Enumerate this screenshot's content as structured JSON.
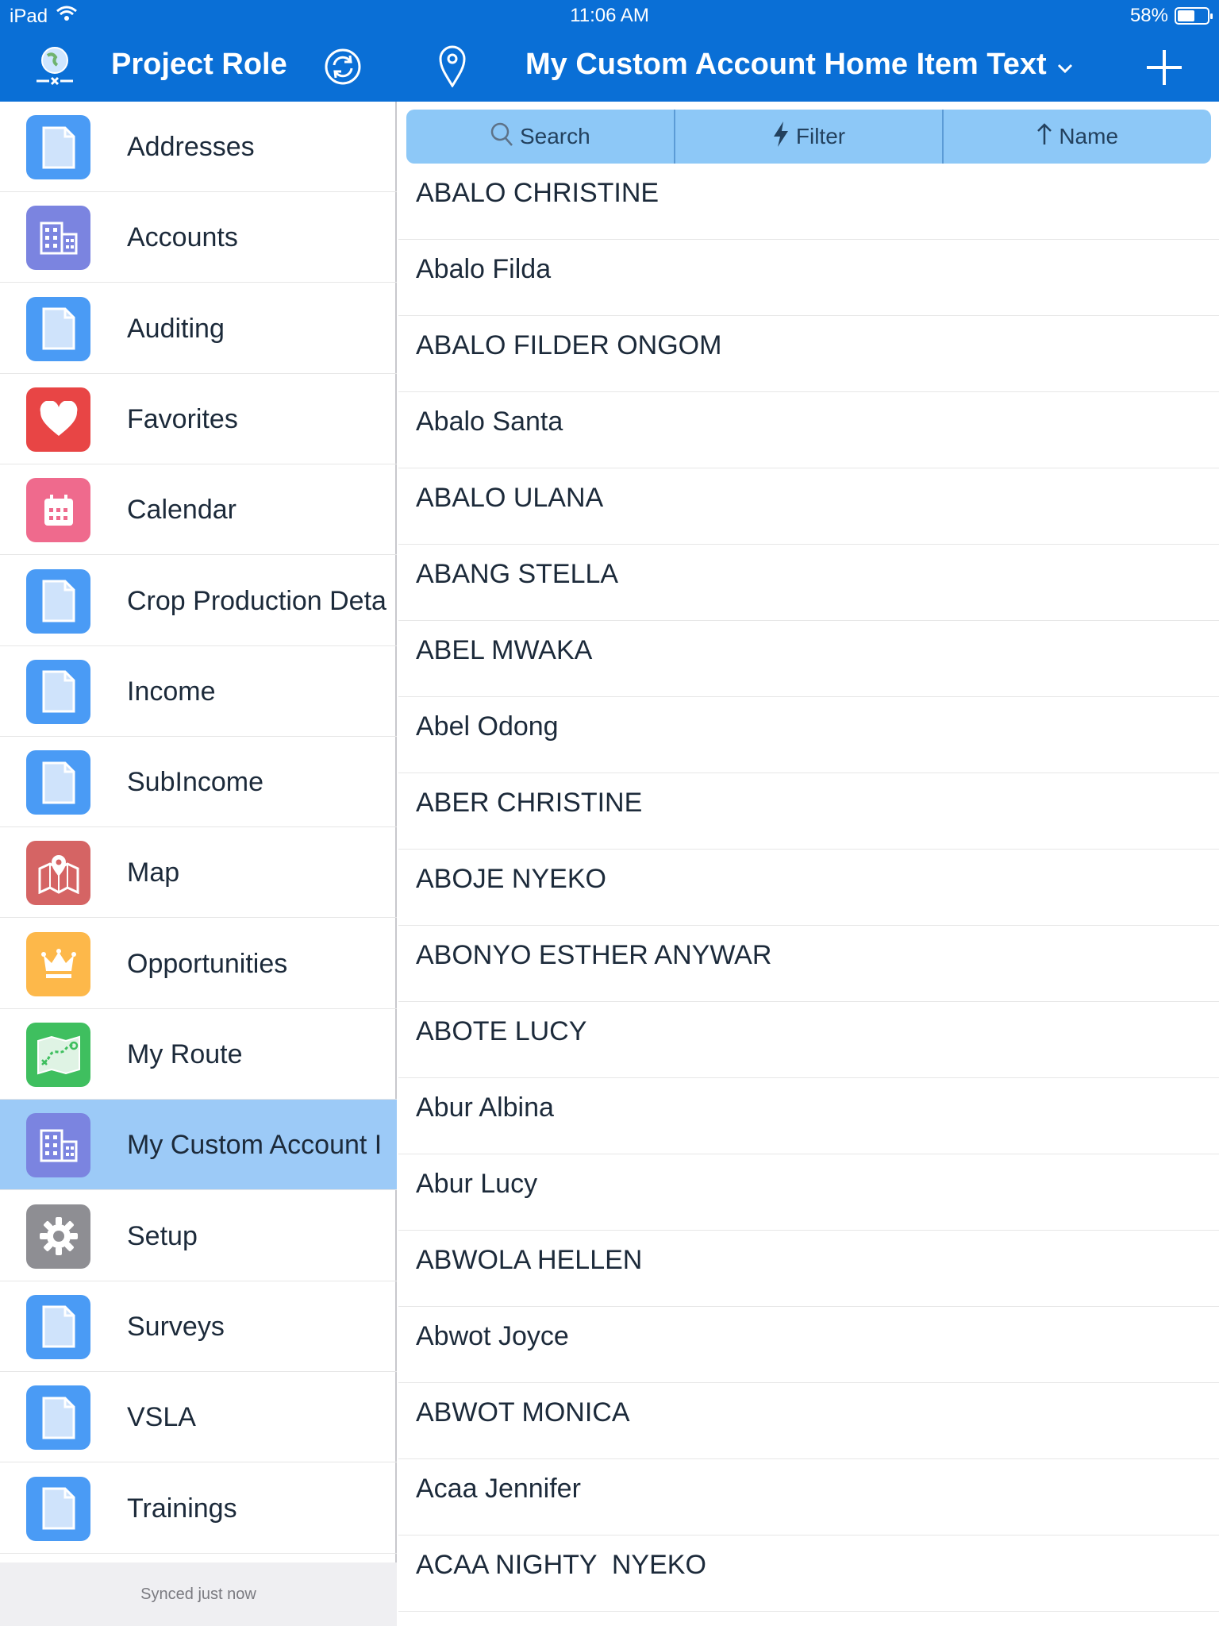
{
  "status_bar": {
    "device": "iPad",
    "time": "11:06 AM",
    "battery": "58%",
    "battery_level": 0.58
  },
  "nav": {
    "left_title": "Project Role",
    "center_title": "My Custom Account Home Item Text",
    "icons": [
      "globe-icon",
      "sync-icon",
      "location-pin-icon",
      "chevron-down-icon",
      "plus-icon"
    ]
  },
  "sidebar": {
    "items": [
      {
        "label": "Addresses",
        "icon": "document-icon",
        "color": "#4a9bf5"
      },
      {
        "label": "Accounts",
        "icon": "building-icon",
        "color": "#7b84e0"
      },
      {
        "label": "Auditing",
        "icon": "document-icon",
        "color": "#4a9bf5"
      },
      {
        "label": "Favorites",
        "icon": "heart-icon",
        "color": "#e84545"
      },
      {
        "label": "Calendar",
        "icon": "calendar-icon",
        "color": "#ef6a8d"
      },
      {
        "label": "Crop Production Deta",
        "icon": "document-icon",
        "color": "#4a9bf5"
      },
      {
        "label": "Income",
        "icon": "document-icon",
        "color": "#4a9bf5"
      },
      {
        "label": "SubIncome",
        "icon": "document-icon",
        "color": "#4a9bf5"
      },
      {
        "label": "Map",
        "icon": "map-icon",
        "color": "#d56464"
      },
      {
        "label": "Opportunities",
        "icon": "crown-icon",
        "color": "#fdb84a"
      },
      {
        "label": "My Route",
        "icon": "route-icon",
        "color": "#3fbf5f"
      },
      {
        "label": "My Custom Account I",
        "icon": "building-icon",
        "color": "#7b84e0",
        "selected": true
      },
      {
        "label": "Setup",
        "icon": "gear-icon",
        "color": "#8e8e93"
      },
      {
        "label": "Surveys",
        "icon": "document-icon",
        "color": "#4a9bf5"
      },
      {
        "label": "VSLA",
        "icon": "document-icon",
        "color": "#4a9bf5"
      },
      {
        "label": "Trainings",
        "icon": "document-icon",
        "color": "#4a9bf5"
      }
    ],
    "footer": "Synced just now"
  },
  "toolbar": {
    "search": "Search",
    "filter": "Filter",
    "sort": "Name"
  },
  "list": {
    "rows": [
      "ABALO CHRISTINE",
      "Abalo Filda",
      "ABALO FILDER ONGOM",
      "Abalo Santa",
      "ABALO ULANA",
      "ABANG STELLA",
      "ABEL MWAKA",
      "Abel Odong",
      "ABER CHRISTINE",
      "ABOJE NYEKO",
      "ABONYO ESTHER ANYWAR",
      "ABOTE LUCY",
      "Abur Albina",
      "Abur Lucy",
      "ABWOLA HELLEN",
      "Abwot Joyce",
      "ABWOT MONICA",
      "Acaa Jennifer",
      "ACAA NIGHTY  NYEKO"
    ]
  }
}
